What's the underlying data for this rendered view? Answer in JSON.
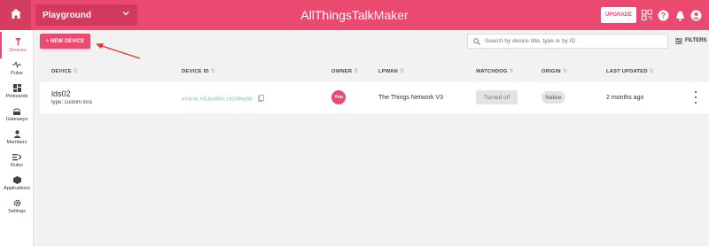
{
  "header": {
    "ground": "Playground",
    "brand_a": "AllThingsTalk",
    "brand_b": "Maker",
    "upgrade_label": "UPGRADE",
    "icons": [
      "home-icon",
      "qr-icon",
      "help-icon",
      "notifications-icon",
      "account-icon"
    ],
    "accent_color": "#ea4a6f"
  },
  "sidebar": {
    "items": [
      {
        "label": "Devices",
        "icon": "devices-icon",
        "active": true
      },
      {
        "label": "Pulse",
        "icon": "pulse-icon"
      },
      {
        "label": "Pinboards",
        "icon": "pinboards-icon"
      },
      {
        "label": "Gateways",
        "icon": "gateways-icon"
      },
      {
        "label": "Members",
        "icon": "members-icon"
      },
      {
        "label": "Rules",
        "icon": "rules-icon"
      },
      {
        "label": "Applications",
        "icon": "applications-icon"
      },
      {
        "label": "Settings",
        "icon": "settings-icon"
      }
    ]
  },
  "toolbar": {
    "new_device_label": "+ NEW DEVICE",
    "search_placeholder": "Search by device title, type or by ID",
    "filters_label": "FILTERS"
  },
  "table": {
    "headers": {
      "device": "DEVICE",
      "device_id": "DEVICE ID",
      "owner": "OWNER",
      "lpwan": "LPWAN",
      "watchdog": "WATCHDOG",
      "origin": "ORIGIN",
      "last_updated": "LAST UPDATED"
    },
    "rows": [
      {
        "name": "lds02",
        "type": "type: custom lora",
        "device_id": "mVmFALt0L0uHB6tiXQ30Hg08",
        "owner": "You",
        "lpwan": "The Things Network V3",
        "watchdog": "Turned off",
        "origin": "Native",
        "last_updated": "2 months ago"
      }
    ]
  }
}
